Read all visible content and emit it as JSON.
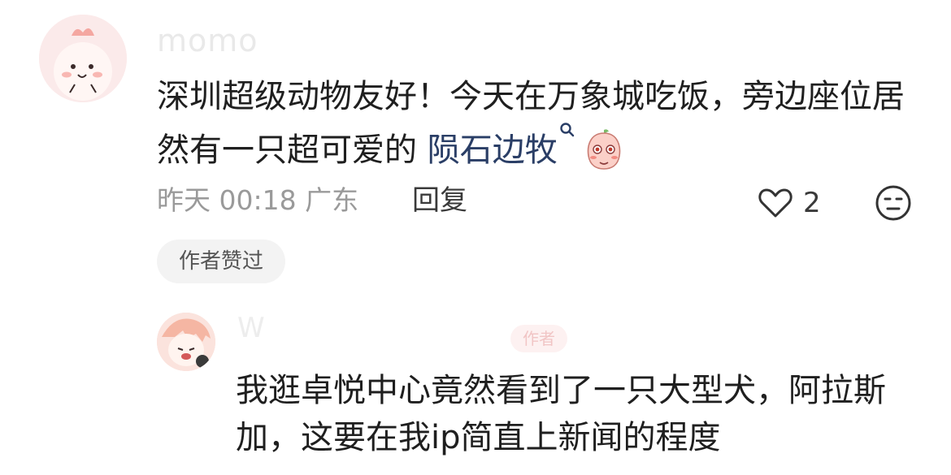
{
  "comment": {
    "username": "momo",
    "text_before": "深圳超级动物友好！今天在万象城吃饭，旁边座位居然有一只超可爱的 ",
    "mention": "陨石边牧",
    "meta": "昨天 00:18 广东",
    "reply_label": "回复",
    "like_count": "2",
    "author_badge": "作者赞过"
  },
  "reply": {
    "username": "W",
    "tag": "作者",
    "text": "我逛卓悦中心竟然看到了一只大型犬，阿拉斯加，这要在我ip简直上新闻的程度"
  },
  "icons": {
    "like": "heart-outline-icon",
    "dislike": "neutral-face-icon",
    "mention_search": "search-icon",
    "emoji": "blushing-peach-emoji-icon"
  },
  "colors": {
    "mention": "#2a3e66",
    "meta": "#9a9a9a",
    "badge_bg": "#f3f3f3"
  }
}
